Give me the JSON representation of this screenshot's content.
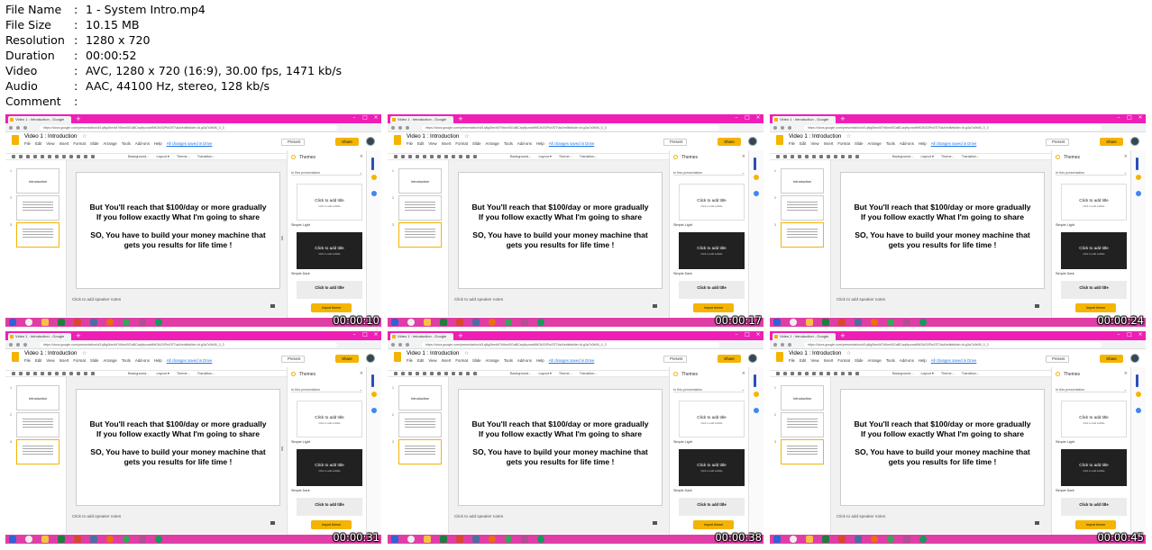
{
  "info": [
    {
      "key": "File Name",
      "value": "1 - System Intro.mp4"
    },
    {
      "key": "File Size",
      "value": "10.15 MB"
    },
    {
      "key": "Resolution",
      "value": "1280 x 720"
    },
    {
      "key": "Duration",
      "value": "00:00:52"
    },
    {
      "key": "Video",
      "value": "AVC, 1280 x 720 (16:9), 30.00 fps, 1471 kb/s"
    },
    {
      "key": "Audio",
      "value": "AAC, 44100 Hz, stereo, 128 kb/s"
    },
    {
      "key": "Comment",
      "value": ""
    }
  ],
  "separator": ":",
  "frame": {
    "browser_tab": "Video 1 : Introduction - Google",
    "new_tab": "+",
    "address": "https://docs.google.com/presentation/d/1qNg0bexM7rl6ne0lGaBCaqHpzwafMK3kG0Pw2STVaA/edit#slide=id.g3a7c0b06_0_3",
    "doc_title": "Video 1 : Introduction",
    "menus": [
      "File",
      "Edit",
      "View",
      "Insert",
      "Format",
      "Slide",
      "Arrange",
      "Tools",
      "Add-ons",
      "Help"
    ],
    "saved": "All changes saved in Drive",
    "present": "Present",
    "share": "Share",
    "toolbar_labels": [
      "Background...",
      "Layout ▾",
      "Theme...",
      "Transition..."
    ],
    "slides": [
      {
        "num": "1",
        "label": "Introduction"
      },
      {
        "num": "2",
        "label": ""
      },
      {
        "num": "3",
        "label": ""
      }
    ],
    "slide_text": {
      "line1": "But You'll reach that $100/day or more gradually",
      "line2": "If you follow exactly What I'm going to share",
      "line3": "SO, You have to build your money machine that",
      "line4": "gets you results for life time !"
    },
    "notes": "Click to add speaker notes",
    "themes": {
      "title": "Themes",
      "subtitle": "In this presentation",
      "card_title": "Click to add title",
      "card_sub": "Click to add subtitle",
      "simple_light": "Simple Light",
      "simple_dark": "Simple Dark",
      "third_title": "Click to add title",
      "import": "Import theme"
    }
  },
  "timestamps": [
    "00:00:10",
    "00:00:17",
    "00:00:24",
    "00:00:31",
    "00:00:38",
    "00:00:45"
  ],
  "colors": {
    "taskbar": "#e03ea6",
    "tabstrip": "#ef1fb5",
    "accent": "#f4b400"
  }
}
